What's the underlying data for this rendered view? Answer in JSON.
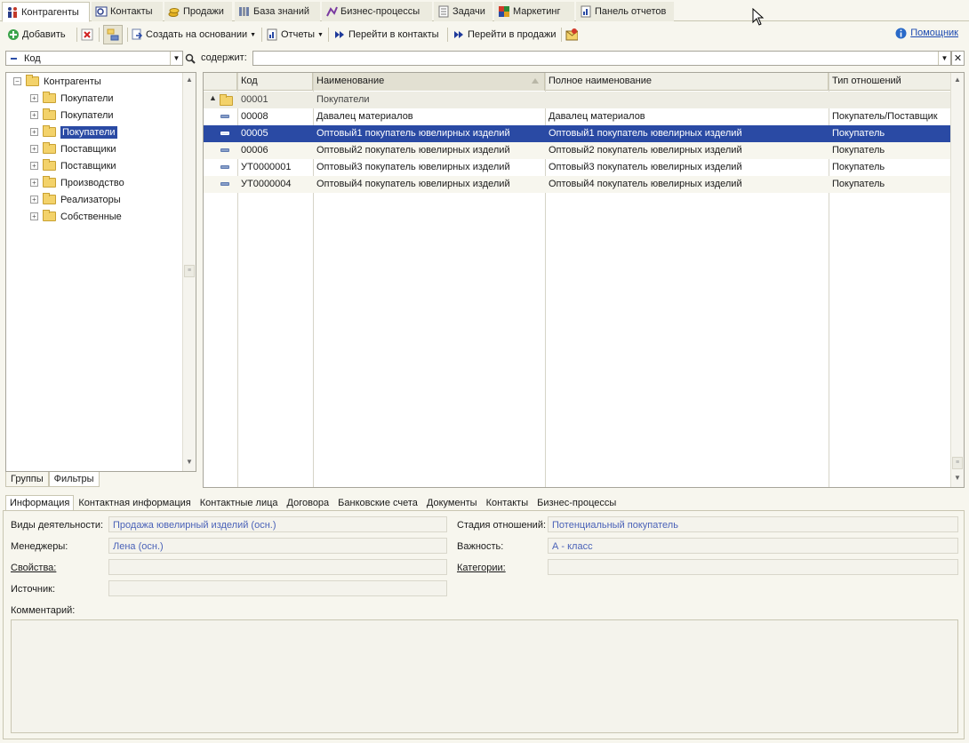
{
  "top_tabs": [
    {
      "label": "Контрагенты",
      "icon": "people-icon",
      "active": true
    },
    {
      "label": "Контакты",
      "icon": "contacts-icon"
    },
    {
      "label": "Продажи",
      "icon": "coins-icon"
    },
    {
      "label": "База знаний",
      "icon": "books-icon"
    },
    {
      "label": "Бизнес-процессы",
      "icon": "process-icon"
    },
    {
      "label": "Задачи",
      "icon": "tasks-icon"
    },
    {
      "label": "Маркетинг",
      "icon": "marketing-icon"
    },
    {
      "label": "Панель отчетов",
      "icon": "reports-panel-icon"
    }
  ],
  "toolbar": {
    "add": "Добавить",
    "create_based": "Создать на основании",
    "reports": "Отчеты",
    "go_contacts": "Перейти в контакты",
    "go_sales": "Перейти в продажи",
    "helper": "Помощник"
  },
  "filter": {
    "field": "Код",
    "contains_label": "содержит:",
    "contains_value": ""
  },
  "tree": {
    "root": "Контрагенты",
    "items": [
      "Покупатели",
      "Покупатели",
      "Покупатели",
      "Поставщики",
      "Поставщики",
      "Производство",
      "Реализаторы",
      "Собственные"
    ],
    "selected_index": 2
  },
  "left_tabs": [
    "Группы",
    "Фильтры"
  ],
  "grid": {
    "columns": [
      "Код",
      "Наименование",
      "Полное наименование",
      "Тип отношений"
    ],
    "group_row": {
      "code": "00001",
      "name": "Покупатели"
    },
    "rows": [
      {
        "code": "00008",
        "name": "Давалец материалов",
        "full_name": "Давалец материалов",
        "type": "Покупатель/Поставщик"
      },
      {
        "code": "00005",
        "name": "Оптовый1 покупатель ювелирных изделий",
        "full_name": "Оптовый1 покупатель ювелирных изделий",
        "type": "Покупатель"
      },
      {
        "code": "00006",
        "name": "Оптовый2 покупатель ювелирных изделий",
        "full_name": "Оптовый2 покупатель ювелирных изделий",
        "type": "Покупатель"
      },
      {
        "code": "УТ0000001",
        "name": "Оптовый3 покупатель ювелирных изделий",
        "full_name": "Оптовый3 покупатель ювелирных изделий",
        "type": "Покупатель"
      },
      {
        "code": "УТ0000004",
        "name": "Оптовый4 покупатель ювелирных изделий",
        "full_name": "Оптовый4 покупатель ювелирных изделий",
        "type": "Покупатель"
      }
    ],
    "selected_index": 1
  },
  "bottom_tabs": [
    "Информация",
    "Контактная информация",
    "Контактные лица",
    "Договора",
    "Банковские счета",
    "Документы",
    "Контакты",
    "Бизнес-процессы"
  ],
  "info": {
    "activity_label": "Виды деятельности:",
    "activity_value": "Продажа ювелирный изделий (осн.)",
    "managers_label": "Менеджеры:",
    "managers_value": "Лена (осн.)",
    "properties_label": "Свойства:",
    "properties_value": "",
    "source_label": "Источник:",
    "source_value": "",
    "stage_label": "Стадия отношений:",
    "stage_value": "Потенциальный покупатель",
    "importance_label": "Важность:",
    "importance_value": "А - класс",
    "categories_label": "Категории:",
    "categories_value": "",
    "comment_label": "Комментарий:"
  }
}
